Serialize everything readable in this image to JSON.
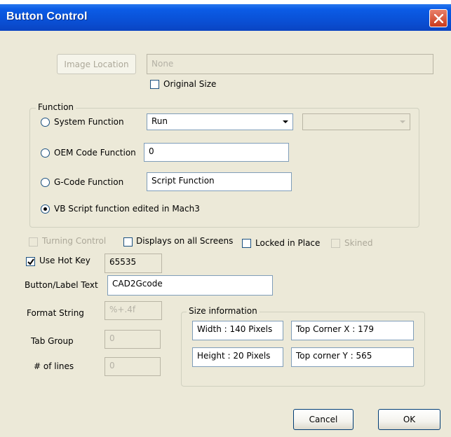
{
  "window": {
    "title": "Button Control"
  },
  "image": {
    "button_label": "Image Location",
    "location_value": "None",
    "original_size_label": "Original Size"
  },
  "function_group": {
    "title": "Function",
    "system_function_label": "System Function",
    "system_function_value": "Run",
    "oem_code_label": "OEM Code Function",
    "oem_code_value": "0",
    "gcode_label": "G-Code Function",
    "gcode_value": "Script Function",
    "vb_script_label": "VB Script function edited in Mach3"
  },
  "options": {
    "turning_control_label": "Turning Control",
    "displays_all_screens_label": "Displays on all Screens",
    "locked_in_place_label": "Locked in Place",
    "skined_label": "Skined",
    "use_hot_key_label": "Use Hot Key",
    "use_hot_key_checked": true,
    "hot_key_value": "65535"
  },
  "button_text": {
    "label": "Button/Label Text",
    "value": "CAD2Gcode"
  },
  "format": {
    "format_label": "Format String",
    "format_value": "%+.4f",
    "tab_group_label": "Tab Group",
    "tab_group_value": "0",
    "lines_label": "# of lines",
    "lines_value": "0"
  },
  "size_info": {
    "title": "Size information",
    "width_text": "Width : 140 Pixels",
    "top_x_text": "Top Corner X : 179",
    "height_text": "Height : 20 Pixels",
    "top_y_text": "Top corner Y : 565"
  },
  "footer": {
    "cancel_label": "Cancel",
    "ok_label": "OK"
  },
  "colors": {
    "titlebar": "#0a4fd4",
    "dialog_bg": "#ece9d8",
    "close_button": "#c93a1c"
  }
}
